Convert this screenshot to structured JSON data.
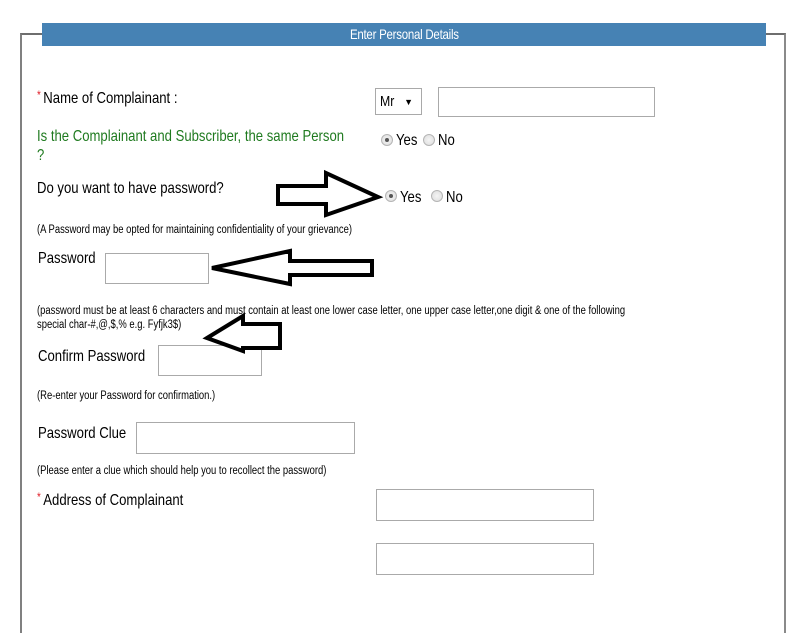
{
  "section_title": "Enter Personal Details",
  "fields": {
    "name": {
      "required_mark": "*",
      "label": "Name of Complainant :",
      "title_select": "Mr",
      "name_value": ""
    },
    "same_person": {
      "label_line1": "Is the Complainant and Subscriber, the same Person",
      "label_line2": "?",
      "options": [
        "Yes",
        "No"
      ],
      "selected": "Yes"
    },
    "want_password": {
      "label": "Do you want to have password?",
      "options": [
        "Yes",
        "No"
      ],
      "selected": "Yes",
      "hint": "(A Password may be opted for maintaining confidentiality of your grievance)"
    },
    "password": {
      "label": "Password",
      "value": "",
      "hint_line1": "(password must be at least 6 characters and must contain at least one lower case letter, one upper case letter,one digit & one of the following",
      "hint_line2": "special char-#,@,$,% e.g. Fyfjk3$)"
    },
    "confirm_password": {
      "label": "Confirm Password",
      "value": "",
      "hint": "(Re-enter your Password for confirmation.)"
    },
    "password_clue": {
      "label": "Password Clue",
      "value": "",
      "hint": "(Please enter a clue which should help you to recollect the password)"
    },
    "address": {
      "required_mark": "*",
      "label": "Address of Complainant",
      "line1": "",
      "line2": ""
    }
  },
  "annotations": {
    "arrow_color": "#000000",
    "arrows": [
      "pointing-right-to-password-yes",
      "pointing-left-to-password-input",
      "pointing-left-to-password-hint"
    ]
  }
}
